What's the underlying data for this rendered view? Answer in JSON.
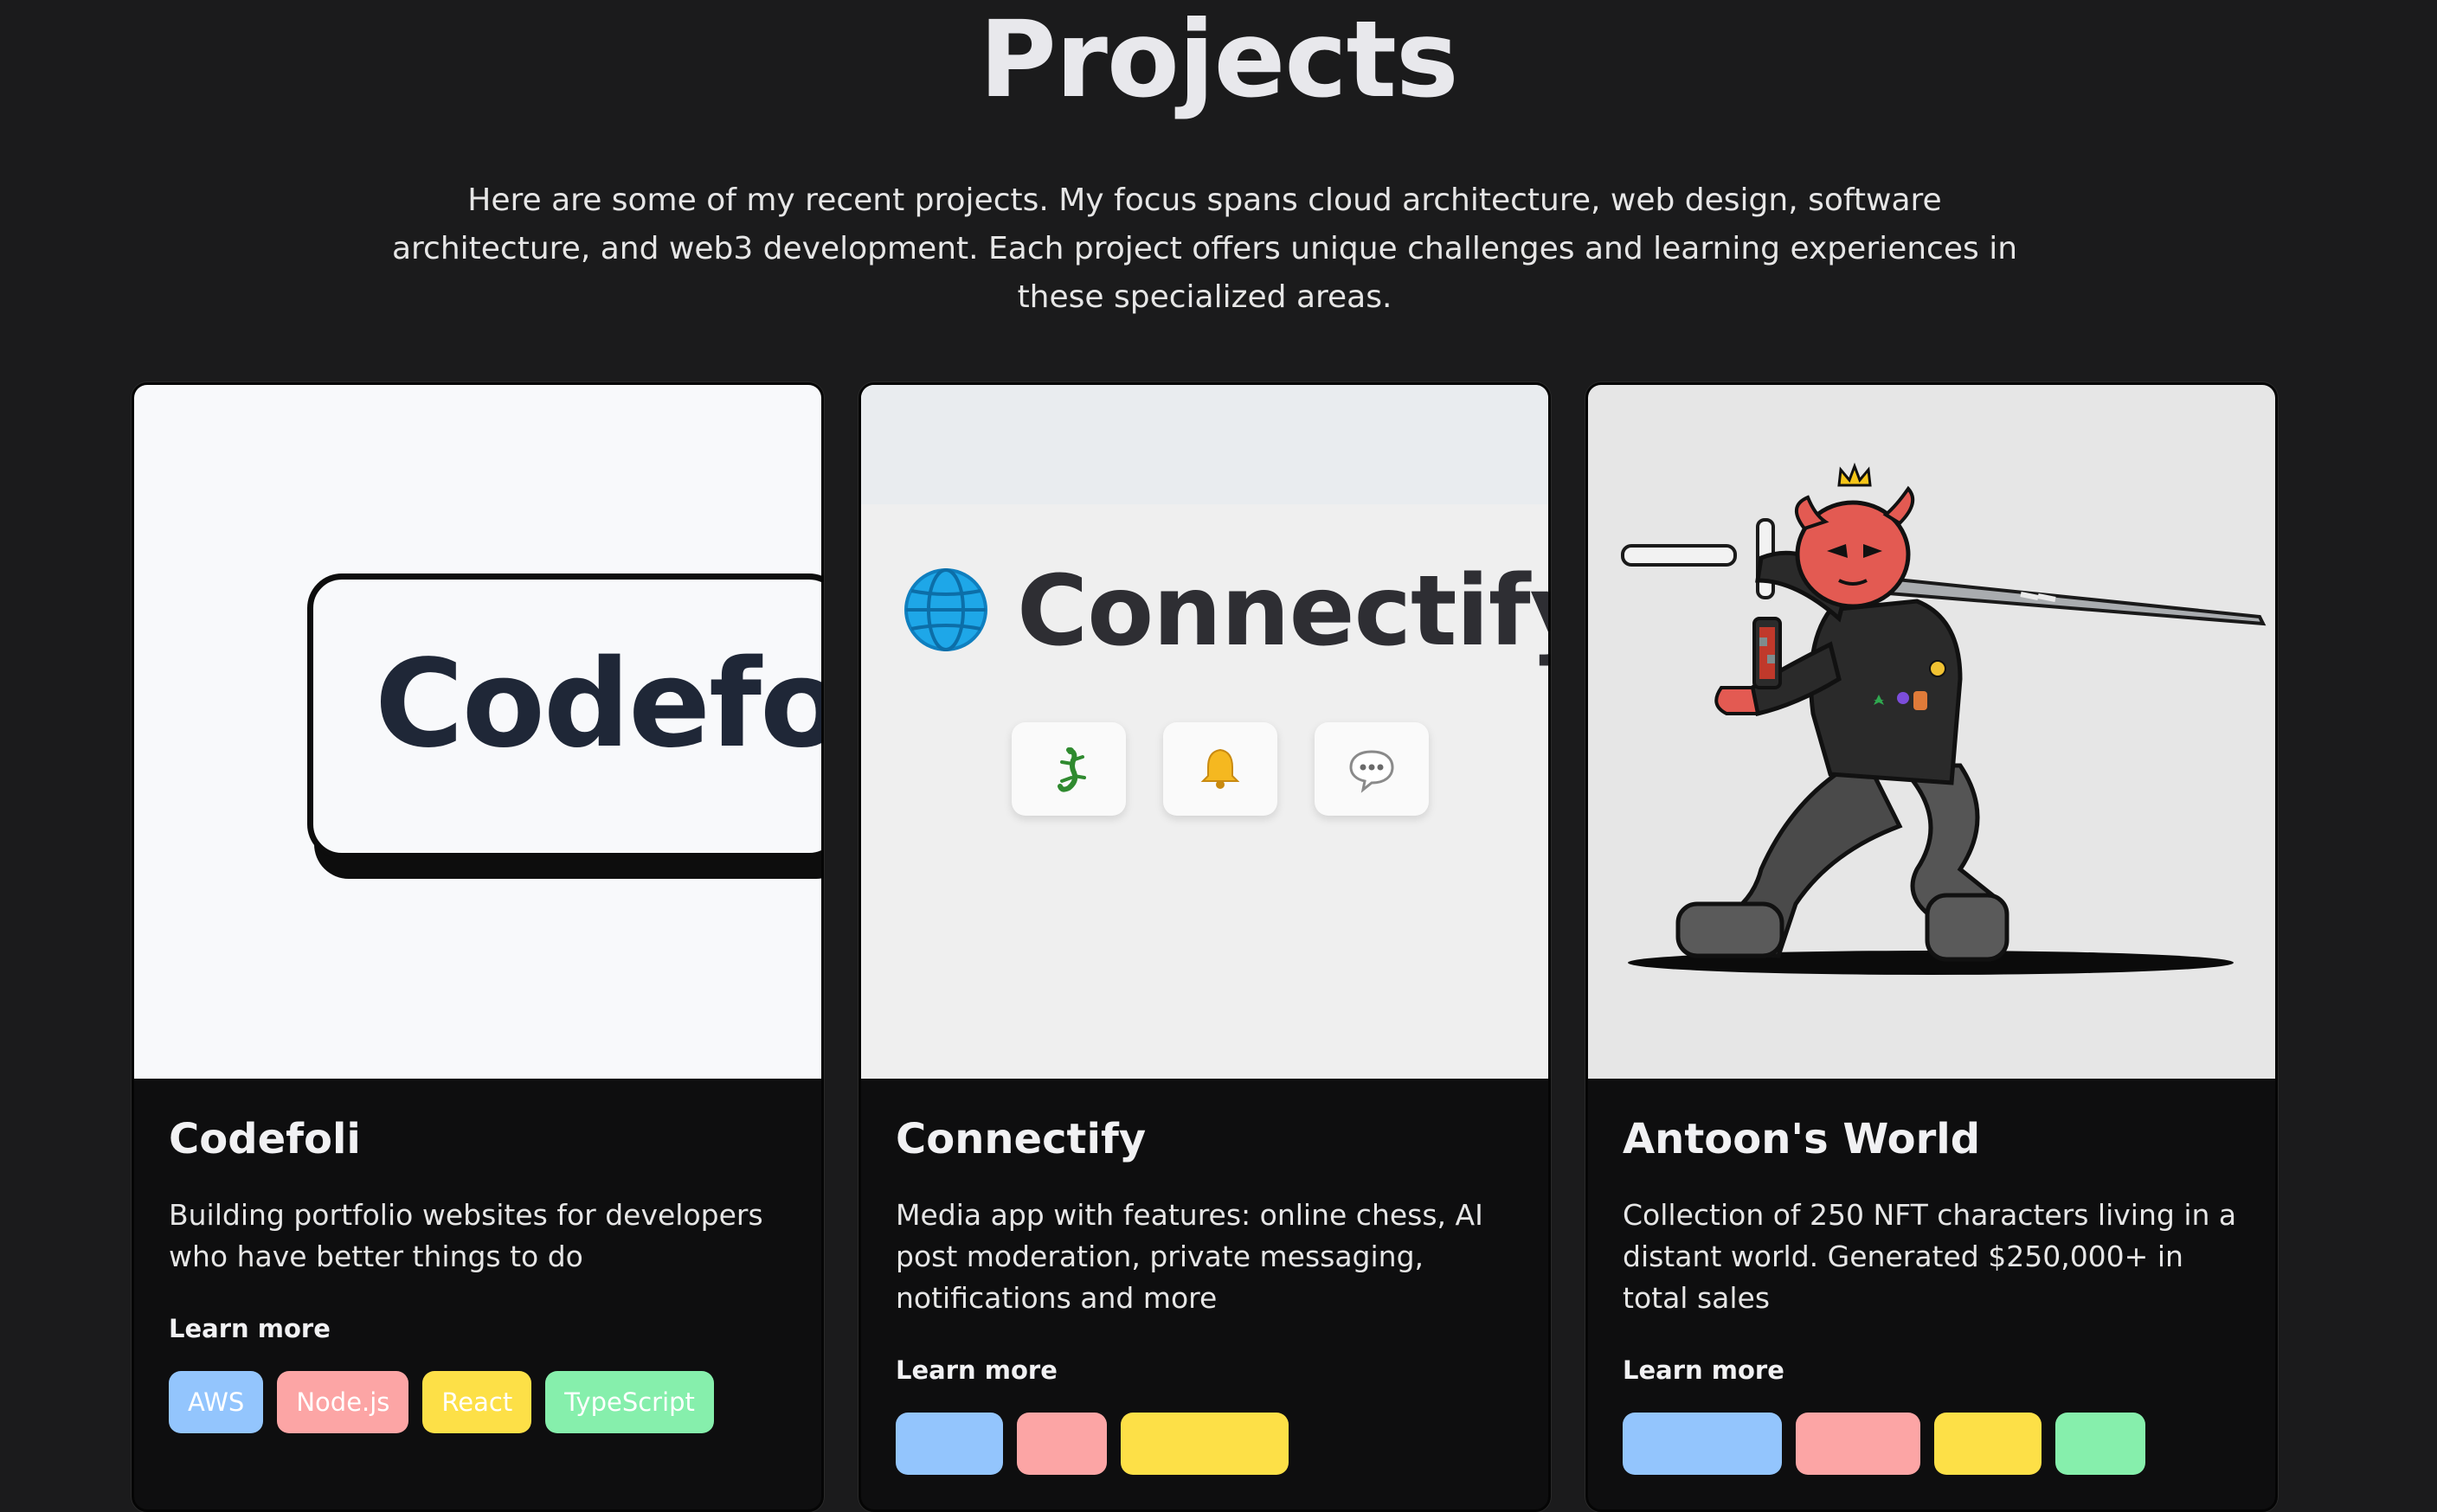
{
  "header": {
    "title": "Projects",
    "intro": "Here are some of my recent projects. My focus spans cloud architecture, web design, software architecture, and web3 development. Each project offers unique challenges and learning experiences in these specialized areas."
  },
  "projects": [
    {
      "title": "Codefoli",
      "image_text": "Codefoli",
      "description": "Building portfolio websites for developers who have better things to do",
      "link_label": "Learn more",
      "tags": [
        "AWS",
        "Node.js",
        "React",
        "TypeScript"
      ]
    },
    {
      "title": "Connectify",
      "image_text": "Connectify",
      "description": "Media app with features: online chess, AI post moderation, private messaging, notifications and more",
      "link_label": "Learn more",
      "tags": []
    },
    {
      "title": "Antoon's World",
      "description": "Collection of 250 NFT characters living in a distant world. Generated $250,000+ in total sales",
      "link_label": "Learn more",
      "tags": []
    }
  ],
  "tag_colors": {
    "blue": "#93c5fd",
    "pink": "#fca5a5",
    "yellow": "#fde047",
    "green": "#86efac"
  },
  "icons": {
    "connectify_features": [
      "lizard-icon",
      "bell-icon",
      "chat-bubble-icon"
    ],
    "connectify_logo": "globe-icon"
  }
}
